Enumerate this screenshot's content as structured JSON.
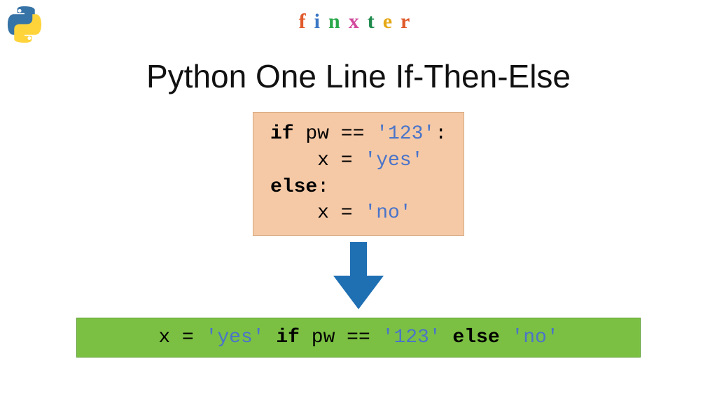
{
  "brand": {
    "letters": [
      "f",
      "i",
      "n",
      "x",
      "t",
      "e",
      "r"
    ],
    "colors": [
      "#e05a2b",
      "#3b78c4",
      "#2aa84a",
      "#d24a9e",
      "#1f8a4c",
      "#e6a817",
      "#e05a2b"
    ]
  },
  "title": "Python One Line If-Then-Else",
  "code_top": {
    "line1_kw": "if",
    "line1_rest": " pw == ",
    "line1_str": "'123'",
    "line1_colon": ":",
    "line2_indent": "    x = ",
    "line2_str": "'yes'",
    "line3_kw": "else",
    "line3_colon": ":",
    "line4_indent": "    x = ",
    "line4_str": "'no'"
  },
  "code_bottom": {
    "p1": "x = ",
    "s1": "'yes'",
    "p2": " ",
    "kw1": "if",
    "p3": " pw == ",
    "s2": "'123'",
    "p4": " ",
    "kw2": "else",
    "p5": " ",
    "s3": "'no'"
  },
  "colors": {
    "arrow": "#1f6fb3",
    "top_box_bg": "#f5c9a6",
    "bottom_box_bg": "#7bc043"
  }
}
